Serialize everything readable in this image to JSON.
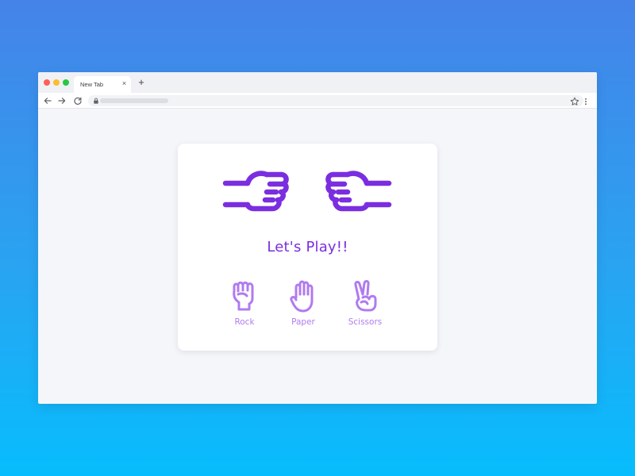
{
  "browser": {
    "tab": {
      "title": "New Tab",
      "close_glyph": "×"
    },
    "new_tab_glyph": "+",
    "icons": {
      "back": "arrow-left-icon",
      "forward": "arrow-right-icon",
      "reload": "reload-icon",
      "lock": "lock-icon",
      "bookmark": "star-icon",
      "menu": "kebab-menu-icon"
    }
  },
  "game": {
    "headline": "Let's Play!!",
    "choices": [
      {
        "label": "Rock",
        "icon": "fist-icon"
      },
      {
        "label": "Paper",
        "icon": "open-hand-icon"
      },
      {
        "label": "Scissors",
        "icon": "peace-hand-icon"
      }
    ],
    "colors": {
      "accent": "#7a2ee0",
      "choice": "#b07bf0",
      "background_top": "#4583e8",
      "background_bottom": "#07bdfd"
    }
  }
}
